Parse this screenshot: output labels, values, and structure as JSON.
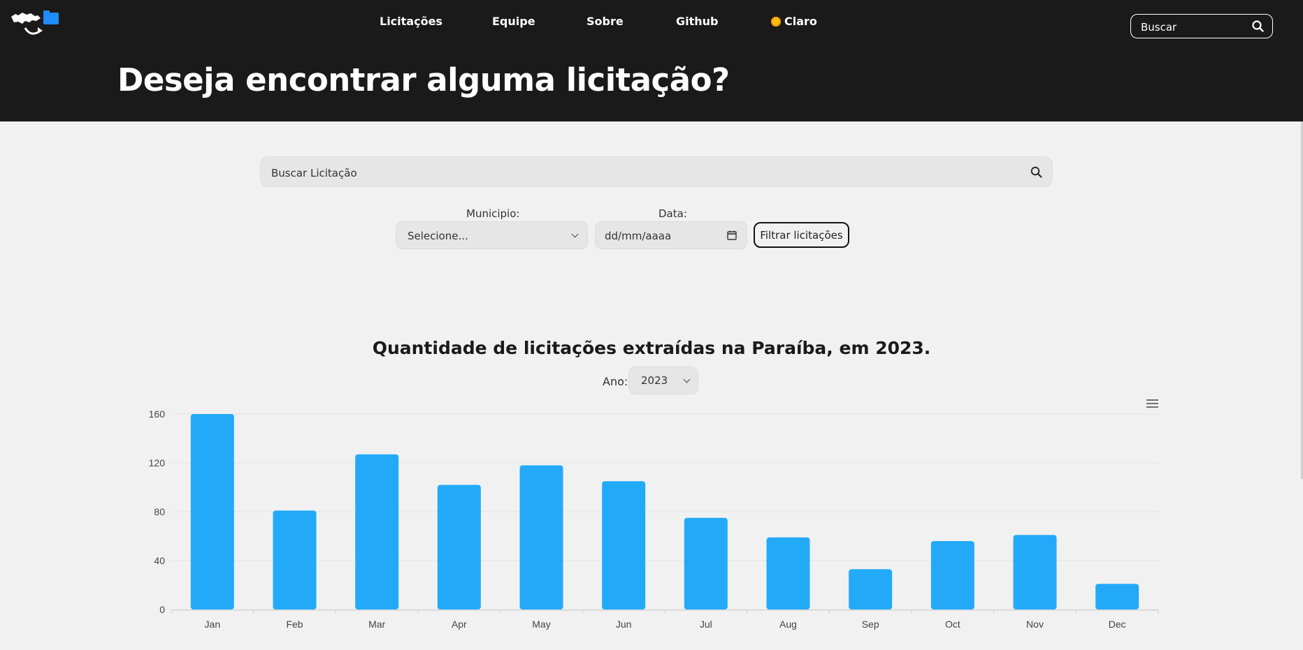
{
  "header": {
    "nav": [
      {
        "label": "Licitações"
      },
      {
        "label": "Equipe"
      },
      {
        "label": "Sobre"
      },
      {
        "label": "Github"
      },
      {
        "label": "Claro"
      }
    ],
    "search_placeholder": "Buscar",
    "hero_title": "Deseja encontrar alguma licitação?"
  },
  "search": {
    "placeholder": "Buscar Licitação"
  },
  "filters": {
    "municipio_label": "Municipio:",
    "municipio_value": "Selecione...",
    "data_label": "Data:",
    "data_placeholder": "dd/mm/aaaa",
    "filter_button": "Filtrar licitações"
  },
  "chart_section": {
    "title": "Quantidade de licitações extraídas na Paraíba, em 2023.",
    "year_label": "Ano:",
    "year_value": "2023"
  },
  "chart_data": {
    "type": "bar",
    "categories": [
      "Jan",
      "Feb",
      "Mar",
      "Apr",
      "May",
      "Jun",
      "Jul",
      "Aug",
      "Sep",
      "Oct",
      "Nov",
      "Dec"
    ],
    "values": [
      160,
      81,
      127,
      102,
      118,
      105,
      75,
      59,
      33,
      56,
      61,
      21
    ],
    "yticks": [
      0,
      40,
      80,
      120,
      160
    ],
    "ylim": [
      0,
      160
    ],
    "grid": true,
    "colors": {
      "bar": "#22aaf9",
      "grid": "#e2e2e2",
      "axis_text": "#444444"
    }
  },
  "colors": {
    "header_bg": "#1a1a1a",
    "page_bg": "#f1f1f1",
    "logo_blue": "#1f8cf7"
  }
}
